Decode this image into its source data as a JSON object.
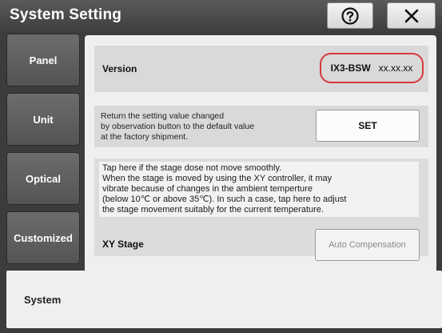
{
  "window": {
    "title": "System Setting",
    "help_icon": "question-circle-icon",
    "close_icon": "close-x-icon"
  },
  "sidebar": {
    "tabs": [
      {
        "label": "Panel"
      },
      {
        "label": "Unit"
      },
      {
        "label": "Optical"
      },
      {
        "label": "Customized"
      },
      {
        "label": "System",
        "active": true
      }
    ]
  },
  "version": {
    "label": "Version",
    "model": "IX3-BSW",
    "number": "xx.xx.xx",
    "highlight_color": "#d8383a"
  },
  "reset": {
    "description_lines": [
      "Return the setting value changed",
      "by observation button to the default value",
      "at the factory shipment."
    ],
    "button_label": "SET"
  },
  "xy_stage": {
    "description_lines": [
      "Tap here if the stage dose not move smoothly.",
      "When the stage is moved by using the XY controller, it may",
      "vibrate because of changes in the ambient temperture",
      "(below 10℃ or above 35℃). In such a case, tap here to adjust",
      "the stage movement suitably for the current temperature."
    ],
    "label": "XY Stage",
    "button_label": "Auto Compensation"
  }
}
